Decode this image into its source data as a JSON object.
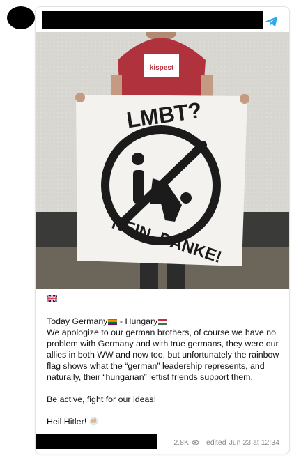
{
  "post": {
    "title_line": "Today Germany",
    "title_tail": "- Hungary",
    "body": "We apologize to our german brothers, of course we have no problem with Germany and with true germans, they were our allies in both WW and now too, but unfortunately the rainbow flag shows what the “german” leadership represents, and naturally, their “hungarian” leftist friends support them.",
    "line2": "Be active, fight for our ideas!",
    "line3": "Heil Hitler!",
    "views": "2.8K",
    "edited_label": "edited",
    "date": "Jun 23 at 12:34"
  },
  "photo": {
    "shirt_text": "kispest",
    "banner_top": "LMBT?",
    "banner_bottom": "NEIN, DANKE!"
  },
  "colors": {
    "telegram": "#2AABEE",
    "shirt": "#b0323c",
    "wall": "#d8d6d0"
  },
  "icons": [
    "telegram-icon",
    "uk-flag-icon",
    "rainbow-flag-icon",
    "hungary-flag-icon",
    "eye-icon",
    "hand-emoji-icon"
  ]
}
